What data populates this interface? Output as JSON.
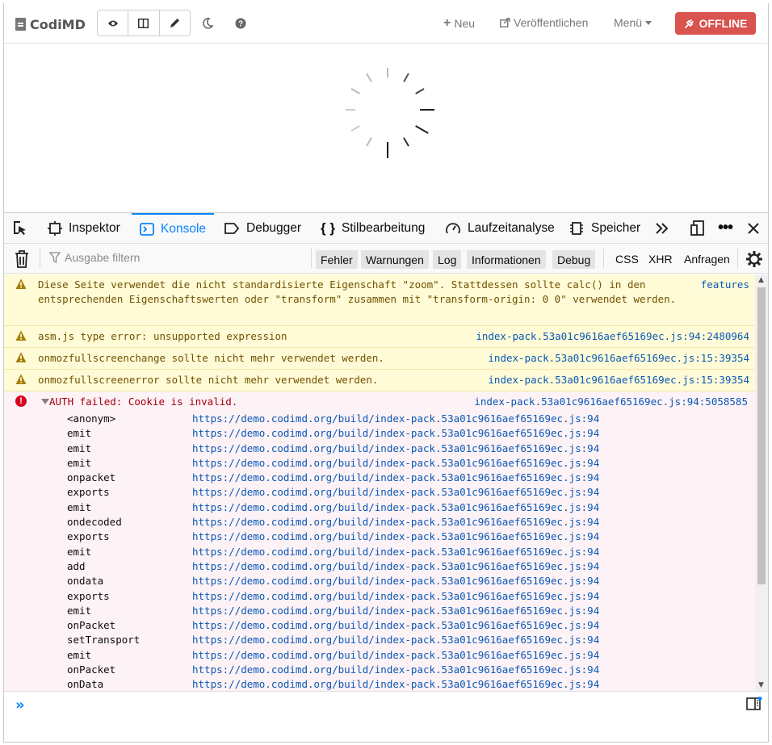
{
  "app": {
    "brand": "CodiMD",
    "nav": {
      "new_label": "Neu",
      "publish_label": "Veröffentlichen",
      "menu_label": "Menü",
      "offline_label": "OFFLINE"
    }
  },
  "devtools": {
    "tabs": [
      {
        "label": "Inspektor",
        "icon": "inspector-icon"
      },
      {
        "label": "Konsole",
        "icon": "console-icon",
        "active": true
      },
      {
        "label": "Debugger",
        "icon": "debugger-icon"
      },
      {
        "label": "Stilbearbeitung",
        "icon": "style-editor-icon"
      },
      {
        "label": "Laufzeitanalyse",
        "icon": "performance-icon"
      },
      {
        "label": "Speicher",
        "icon": "memory-icon"
      }
    ],
    "filter": {
      "placeholder": "Ausgabe filtern",
      "levels": [
        "Fehler",
        "Warnungen",
        "Log",
        "Informationen",
        "Debug"
      ],
      "extras": [
        "CSS",
        "XHR",
        "Anfragen"
      ]
    },
    "messages": [
      {
        "type": "warning",
        "text": "Diese Seite verwendet die nicht standardisierte Eigenschaft \"zoom\". Stattdessen sollte calc() in den entsprechenden Eigenschaftswerten oder \"transform\" zusammen mit \"transform-origin: 0 0\" verwendet werden.",
        "source": "features",
        "line": ""
      },
      {
        "type": "warning",
        "text": "asm.js type error: unsupported expression",
        "source": "index-pack.53a01c9616aef65169ec.js",
        "line": ":94:2480964"
      },
      {
        "type": "warning",
        "text": "onmozfullscreenchange sollte nicht mehr verwendet werden.",
        "source": "index-pack.53a01c9616aef65169ec.js",
        "line": ":15:39354"
      },
      {
        "type": "warning",
        "text": "onmozfullscreenerror sollte nicht mehr verwendet werden.",
        "source": "index-pack.53a01c9616aef65169ec.js",
        "line": ":15:39354"
      }
    ],
    "error": {
      "text": "AUTH failed: Cookie is invalid.",
      "source": "index-pack.53a01c9616aef65169ec.js",
      "line": ":94:5058585",
      "stack_url": "https://demo.codimd.org/build/index-pack.53a01c9616aef65169ec.js",
      "stack_line": ":94",
      "stack": [
        "<anonym>",
        "emit",
        "emit",
        "emit",
        "onpacket",
        "exports",
        "emit",
        "ondecoded",
        "exports",
        "emit",
        "add",
        "ondata",
        "exports",
        "emit",
        "onPacket",
        "setTransport",
        "emit",
        "onPacket",
        "onData"
      ]
    }
  }
}
